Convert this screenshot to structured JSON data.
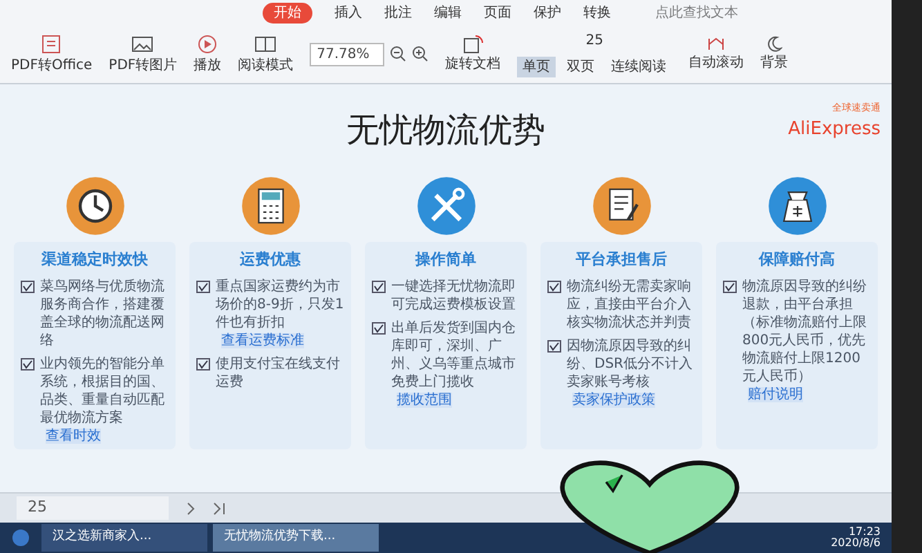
{
  "toolbar": {
    "tabs": [
      {
        "label": "开始",
        "selected": true
      },
      {
        "label": "插入",
        "selected": false
      },
      {
        "label": "批注",
        "selected": false
      },
      {
        "label": "编辑",
        "selected": false
      },
      {
        "label": "页面",
        "selected": false
      },
      {
        "label": "保护",
        "selected": false
      },
      {
        "label": "转换",
        "selected": false
      }
    ],
    "search": {
      "placeholder": "点此查找文本"
    },
    "tools": [
      {
        "kind": "pdf-office",
        "label": "PDF转Office"
      },
      {
        "kind": "pdf-image",
        "label": "PDF转图片"
      },
      {
        "kind": "play",
        "label": "播放"
      },
      {
        "kind": "read",
        "label": "阅读模式"
      }
    ],
    "zoom": "77.78%",
    "rotate": "旋转文档",
    "page": "25",
    "views": [
      {
        "label": "单页",
        "selected": true
      },
      {
        "label": "双页",
        "selected": false
      },
      {
        "label": "连续阅读",
        "selected": false
      }
    ],
    "autoscroll": "自动滚动",
    "background": "背景"
  },
  "slide": {
    "title": "无忧物流优势",
    "logo": {
      "brand": "AliExpress",
      "tagline": "全球速卖通"
    },
    "cards": [
      {
        "kind": "clock",
        "color": "#e8943a",
        "heading": "渠道稳定时效快",
        "items": [
          {
            "checked": true,
            "text": "菜鸟网络与优质物流服务商合作，搭建覆盖全球的物流配送网络"
          },
          {
            "checked": true,
            "text": "业内领先的智能分单系统，根据目的国、品类、重量自动匹配最优物流方案",
            "link": "查看时效"
          }
        ]
      },
      {
        "kind": "calculator",
        "color": "#e8943a",
        "heading": "运费优惠",
        "items": [
          {
            "checked": true,
            "text": "重点国家运费约为市场价的8-9折，只发1件也有折扣",
            "link": "查看运费标准"
          },
          {
            "checked": true,
            "text": "使用支付宝在线支付运费"
          }
        ]
      },
      {
        "kind": "tools",
        "color": "#2f8fd8",
        "heading": "操作简单",
        "items": [
          {
            "checked": true,
            "text": "一键选择无忧物流即可完成运费模板设置"
          },
          {
            "checked": true,
            "text": "出单后发货到国内仓库即可，深圳、广州、义乌等重点城市免费上门揽收",
            "link": "揽收范围"
          }
        ]
      },
      {
        "kind": "document",
        "color": "#e8943a",
        "heading": "平台承担售后",
        "items": [
          {
            "checked": true,
            "text": "物流纠纷无需卖家响应，直接由平台介入核实物流状态并判责"
          },
          {
            "checked": true,
            "text": "因物流原因导致的纠纷、DSR低分不计入卖家账号考核",
            "link": "卖家保护政策"
          }
        ]
      },
      {
        "kind": "money-bag",
        "color": "#2f8fd8",
        "heading": "保障赔付高",
        "items": [
          {
            "checked": true,
            "text": "物流原因导致的纠纷退款，由平台承担（标准物流赔付上限800元人民币，优先物流赔付上限1200元人民币）",
            "link": "赔付说明"
          }
        ]
      }
    ]
  },
  "status_bar": {
    "page": "25"
  },
  "taskbar": {
    "items": [
      {
        "label": "汉之选新商家入...",
        "selected": false
      },
      {
        "label": "无忧物流优势下载...",
        "selected": true
      }
    ],
    "time": "17:23",
    "date": "2020/8/6"
  }
}
